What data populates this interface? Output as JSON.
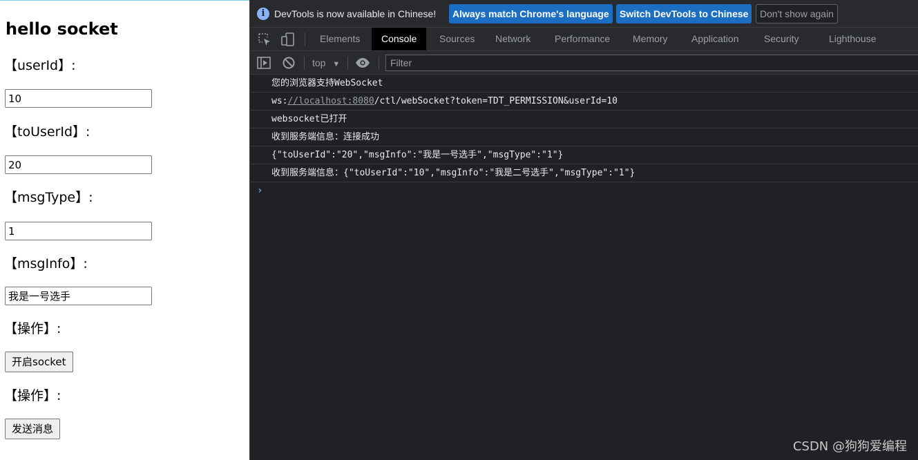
{
  "page": {
    "heading": "hello socket",
    "fields": [
      {
        "label": "【userId】:",
        "value": "10"
      },
      {
        "label": "【toUserId】:",
        "value": "20"
      },
      {
        "label": "【msgType】:",
        "value": "1"
      },
      {
        "label": "【msgInfo】:",
        "value": "我是一号选手"
      }
    ],
    "actions": [
      {
        "label": "【操作】:",
        "button": "开启socket"
      },
      {
        "label": "【操作】:",
        "button": "发送消息"
      }
    ]
  },
  "devtools": {
    "infobar": {
      "text": "DevTools is now available in Chinese!",
      "match_button": "Always match Chrome's language",
      "switch_button": "Switch DevTools to Chinese",
      "dismiss_button": "Don't show again"
    },
    "tabs": [
      "Elements",
      "Console",
      "Sources",
      "Network",
      "Performance",
      "Memory",
      "Application",
      "Security",
      "Lighthouse"
    ],
    "active_tab": "Console",
    "console_toolbar": {
      "context": "top",
      "filter_placeholder": "Filter"
    },
    "messages": [
      {
        "text": "您的浏览器支持WebSocket"
      },
      {
        "prefix": "ws:",
        "link": "//localhost:8080",
        "suffix": "/ctl/webSocket?token=TDT_PERMISSION&userId=10"
      },
      {
        "text": "websocket已打开"
      },
      {
        "text": "收到服务端信息：连接成功"
      },
      {
        "text": "{\"toUserId\":\"20\",\"msgInfo\":\"我是一号选手\",\"msgType\":\"1\"}"
      },
      {
        "text": "收到服务端信息：{\"toUserId\":\"10\",\"msgInfo\":\"我是二号选手\",\"msgType\":\"1\"}"
      }
    ],
    "prompt_symbol": "›"
  },
  "watermark": "CSDN @狗狗爱编程",
  "colors": {
    "devtools_bg": "#202124",
    "toolbar_bg": "#292a2d",
    "primary_button": "#1b6ec2",
    "prompt": "#8ab4f8"
  },
  "icons": [
    "info-icon",
    "inspect-element-icon",
    "device-toggle-icon",
    "sidebar-toggle-icon",
    "clear-console-icon",
    "eye-icon",
    "dropdown-arrow-icon"
  ]
}
